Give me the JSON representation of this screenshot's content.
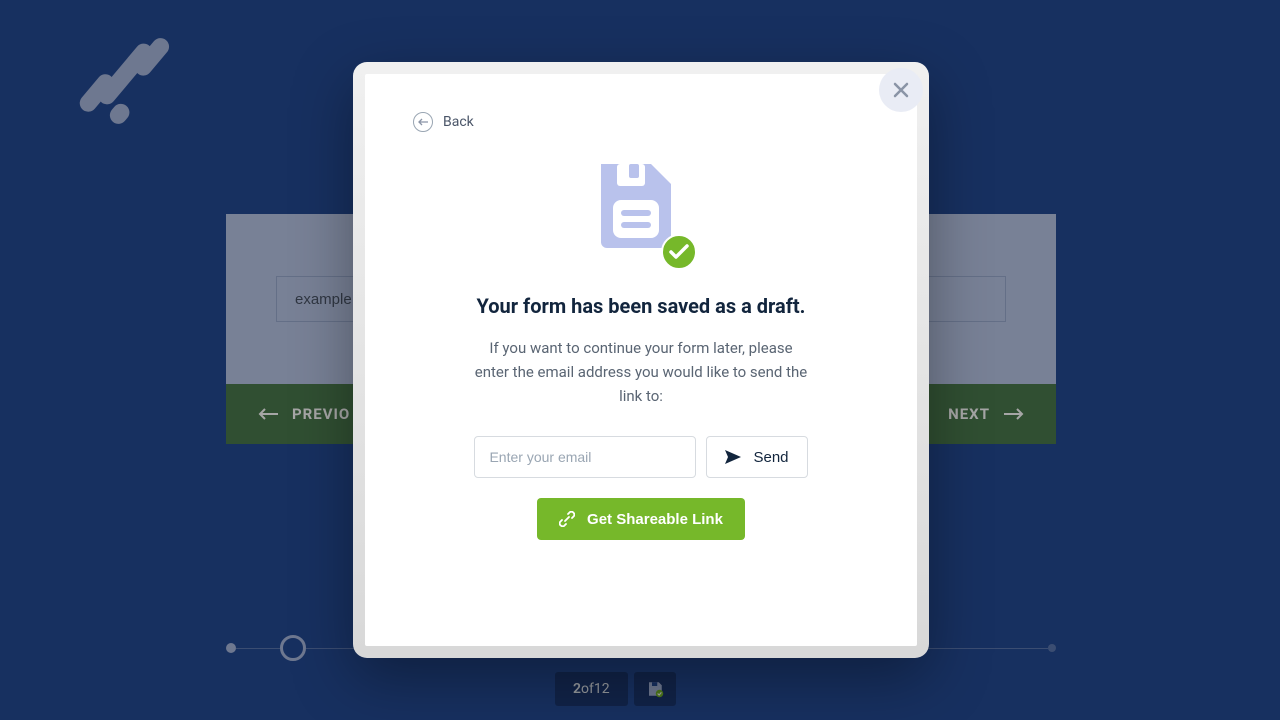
{
  "background": {
    "input_value": "example",
    "prev_label": "PREVIO",
    "next_label": "NEXT",
    "pager_current": "2",
    "pager_total": "12",
    "pager_sep": " of "
  },
  "modal": {
    "back_label": "Back",
    "title": "Your form has been saved as a draft.",
    "description": "If you want to continue your form later, please enter the email address you would like to send the link to:",
    "email_placeholder": "Enter your email",
    "send_label": "Send",
    "share_label": "Get Shareable Link"
  }
}
